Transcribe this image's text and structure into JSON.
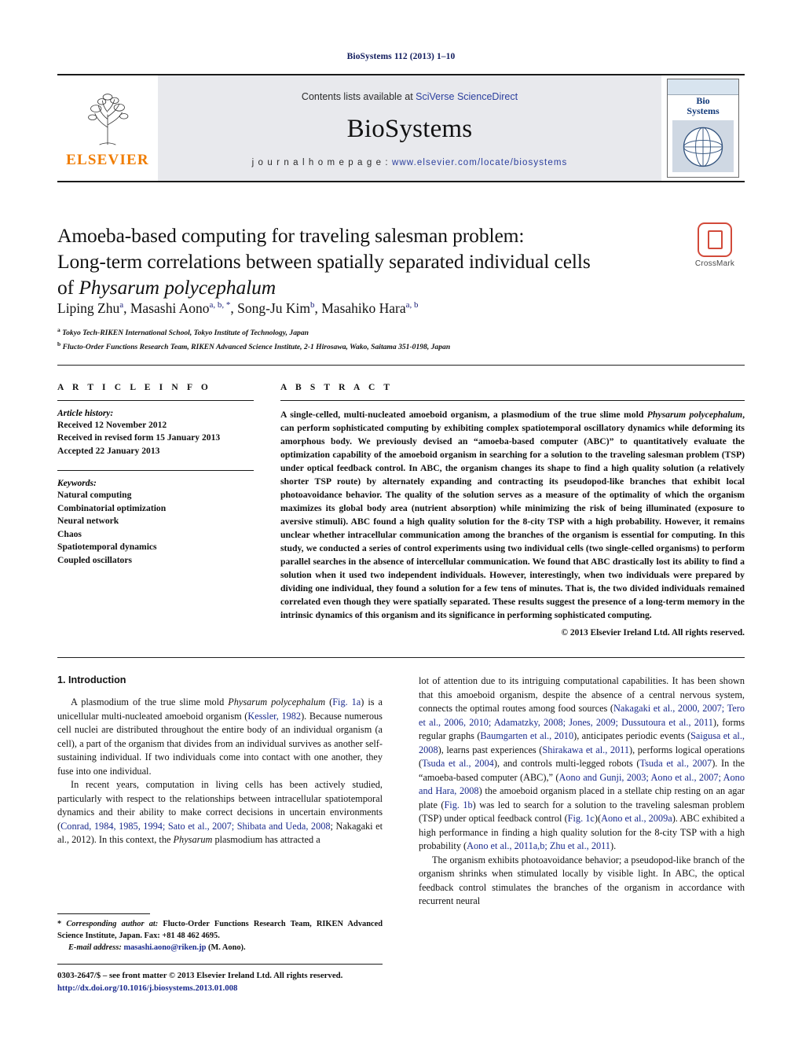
{
  "running_head": "BioSystems 112 (2013) 1–10",
  "masthead": {
    "contents_prefix": "Contents lists available at ",
    "contents_link": "SciVerse ScienceDirect",
    "journal_title": "BioSystems",
    "homepage_prefix": "j o u r n a l   h o m e p a g e :   ",
    "homepage_url": "www.elsevier.com/locate/biosystems",
    "publisher": "ELSEVIER",
    "cover_title_line1": "Bio",
    "cover_title_line2": "Systems",
    "accent_orange": "#f07c00",
    "link_blue": "#2b3f9e"
  },
  "article": {
    "title_line1": "Amoeba-based computing for traveling salesman problem:",
    "title_line2": "Long-term correlations between spatially separated individual cells",
    "title_line3_prefix": "of ",
    "title_line3_italic": "Physarum polycephalum",
    "crossmark_label": "CrossMark",
    "authors": [
      {
        "name": "Liping Zhu",
        "sup": "a"
      },
      {
        "name": "Masashi Aono",
        "sup": "a, b, *"
      },
      {
        "name": "Song-Ju Kim",
        "sup": "b"
      },
      {
        "name": "Masahiko Hara",
        "sup": "a, b"
      }
    ],
    "affiliations": [
      {
        "marker": "a",
        "text": "Tokyo Tech-RIKEN International School, Tokyo Institute of Technology, Japan"
      },
      {
        "marker": "b",
        "text": "Flucto-Order Functions Research Team, RIKEN Advanced Science Institute, 2-1 Hirosawa, Wako, Saitama 351-0198, Japan"
      }
    ]
  },
  "article_info": {
    "label": "A R T I C L E  I N F O",
    "history_head": "Article history:",
    "history": [
      "Received 12 November 2012",
      "Received in revised form 15 January 2013",
      "Accepted 22 January 2013"
    ],
    "keywords_head": "Keywords:",
    "keywords": [
      "Natural computing",
      "Combinatorial optimization",
      "Neural network",
      "Chaos",
      "Spatiotemporal dynamics",
      "Coupled oscillators"
    ]
  },
  "abstract": {
    "label": "A B S T R A C T",
    "part1": "A single-celled, multi-nucleated amoeboid organism, a plasmodium of the true slime mold ",
    "organism": "Physarum polycephalum",
    "part2": ", can perform sophisticated computing by exhibiting complex spatiotemporal oscillatory dynamics while deforming its amorphous body. We previously devised an “amoeba-based computer (ABC)” to quantitatively evaluate the optimization capability of the amoeboid organism in searching for a solution to the traveling salesman problem (TSP) under optical feedback control. In ABC, the organism changes its shape to find a high quality solution (a relatively shorter TSP route) by alternately expanding and contracting its pseudopod-like branches that exhibit local photoavoidance behavior. The quality of the solution serves as a measure of the optimality of which the organism maximizes its global body area (nutrient absorption) while minimizing the risk of being illuminated (exposure to aversive stimuli). ABC found a high quality solution for the 8-city TSP with a high probability. However, it remains unclear whether intracellular communication among the branches of the organism is essential for computing. In this study, we conducted a series of control experiments using two individual cells (two single-celled organisms) to perform parallel searches in the absence of intercellular communication. We found that ABC drastically lost its ability to find a solution when it used two independent individuals. However, interestingly, when two individuals were prepared by dividing one individual, they found a solution for a few tens of minutes. That is, the two divided individuals remained correlated even though they were spatially separated. These results suggest the presence of a long-term memory in the intrinsic dynamics of this organism and its significance in performing sophisticated computing.",
    "copyright": "© 2013 Elsevier Ireland Ltd. All rights reserved."
  },
  "body": {
    "section1_heading": "1.  Introduction",
    "left_p1_a": "A plasmodium of the true slime mold ",
    "left_p1_italic": "Physarum polycephalum",
    "left_p1_b": " (",
    "left_p1_ref1": "Fig. 1a",
    "left_p1_c": ") is a unicellular multi-nucleated amoeboid organism (",
    "left_p1_ref2": "Kessler, 1982",
    "left_p1_d": "). Because numerous cell nuclei are distributed throughout the entire body of an individual organism (a cell), a part of the organism that divides from an individual survives as another self-sustaining individual. If two individuals come into contact with one another, they fuse into one individual.",
    "left_p2_a": "In recent years, computation in living cells has been actively studied, particularly with respect to the relationships between intracellular spatiotemporal dynamics and their ability to make correct decisions in uncertain environments (",
    "left_p2_ref1": "Conrad, 1984, 1985, 1994; Sato et al., 2007; Shibata and Ueda, 2008",
    "left_p2_b": "; Nakagaki et al., 2012). In this context, the ",
    "left_p2_italic": "Physarum",
    "left_p2_c": " plasmodium has attracted a",
    "right_p1_a": "lot of attention due to its intriguing computational capabilities. It has been shown that this amoeboid organism, despite the absence of a central nervous system, connects the optimal routes among food sources (",
    "right_p1_ref1": "Nakagaki et al., 2000, 2007; Tero et al., 2006, 2010; Adamatzky, 2008; Jones, 2009; Dussutoura et al., 2011",
    "right_p1_b": "), forms regular graphs (",
    "right_p1_ref2": "Baumgarten et al., 2010",
    "right_p1_c": "), anticipates periodic events (",
    "right_p1_ref3": "Saigusa et al., 2008",
    "right_p1_d": "), learns past experiences (",
    "right_p1_ref4": "Shirakawa et al., 2011",
    "right_p1_e": "), performs logical operations (",
    "right_p1_ref5": "Tsuda et al., 2004",
    "right_p1_f": "), and controls multi-legged robots (",
    "right_p1_ref6": "Tsuda et al., 2007",
    "right_p1_g": "). In the “amoeba-based computer (ABC),” (",
    "right_p1_ref7": "Aono and Gunji, 2003; Aono et al., 2007; Aono and Hara, 2008",
    "right_p1_h": ") the amoeboid organism placed in a stellate chip resting on an agar plate (",
    "right_p1_ref8": "Fig. 1b",
    "right_p1_i": ") was led to search for a solution to the traveling salesman problem (TSP) under optical feedback control (",
    "right_p1_ref9": "Fig. 1c",
    "right_p1_j": ")(",
    "right_p1_ref10": "Aono et al., 2009a",
    "right_p1_k": "). ABC exhibited a high performance in finding a high quality solution for the 8-city TSP with a high probability (",
    "right_p1_ref11": "Aono et al., 2011a,b; Zhu et al., 2011",
    "right_p1_l": ").",
    "right_p2": "The organism exhibits photoavoidance behavior; a pseudopod-like branch of the organism shrinks when stimulated locally by visible light. In ABC, the optical feedback control stimulates the branches of the organism in accordance with recurrent neural"
  },
  "footer": {
    "corresponding_a": "* ",
    "corresponding_italic": "Corresponding author at:",
    "corresponding_b": " Flucto-Order Functions Research Team, RIKEN Advanced Science Institute, Japan. Fax: +81 48 462 4695.",
    "email_label": "E-mail address:",
    "email": "masashi.aono@riken.jp",
    "email_suffix": " (M. Aono).",
    "imprint_line": "0303-2647/$ – see front matter © 2013 Elsevier Ireland Ltd. All rights reserved.",
    "doi": "http://dx.doi.org/10.1016/j.biosystems.2013.01.008"
  }
}
